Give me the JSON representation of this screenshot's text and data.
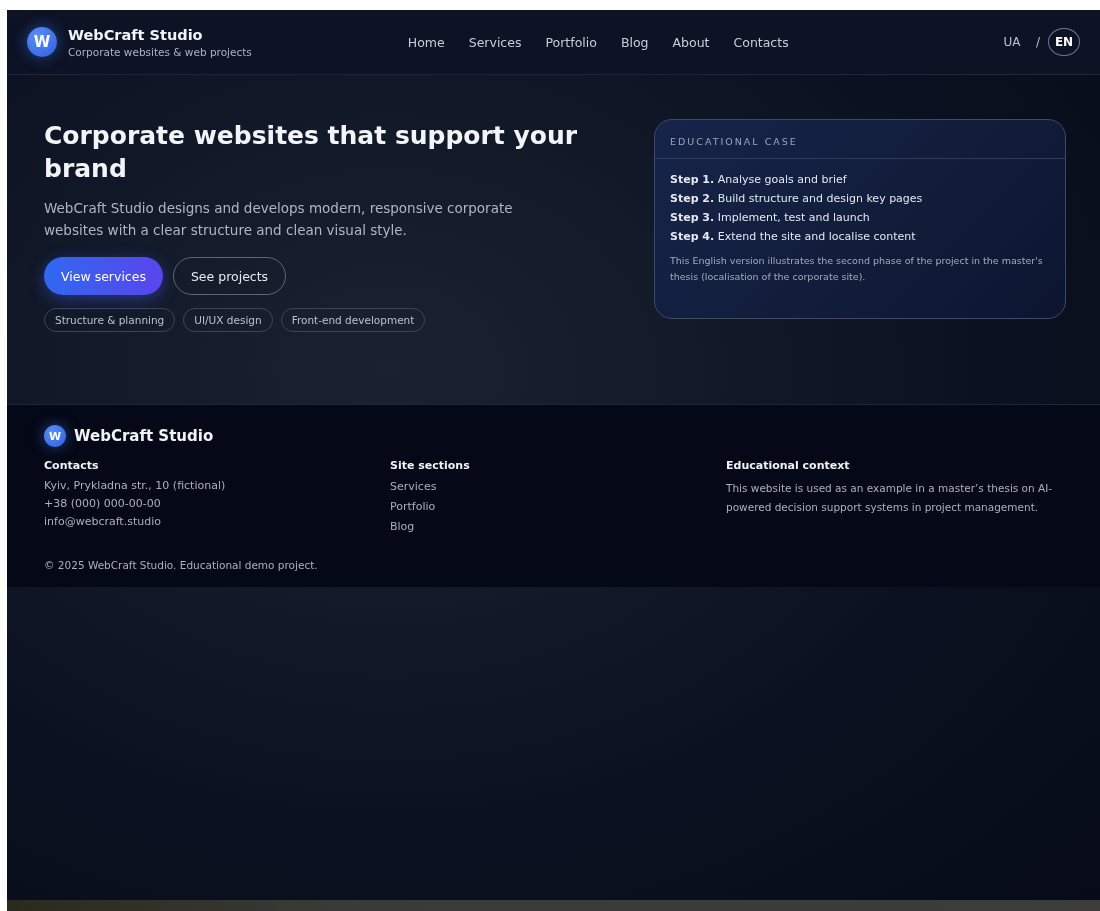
{
  "header": {
    "logo_letter": "W",
    "brand": "WebCraft Studio",
    "tagline": "Corporate websites & web projects",
    "nav": [
      {
        "label": "Home"
      },
      {
        "label": "Services"
      },
      {
        "label": "Portfolio"
      },
      {
        "label": "Blog"
      },
      {
        "label": "About"
      },
      {
        "label": "Contacts"
      }
    ],
    "languages": [
      {
        "label": "UA",
        "selected": false
      },
      {
        "label": "EN",
        "selected": true
      }
    ],
    "language_separator": "/"
  },
  "hero": {
    "title": "Corporate websites that support your brand",
    "lead": "WebCraft Studio designs and develops modern, responsive corporate websites with a clear structure and clean visual style.",
    "buttons": [
      {
        "label": "View services",
        "kind": "primary"
      },
      {
        "label": "See projects",
        "kind": "outline"
      }
    ],
    "tags": [
      "Structure & planning",
      "UI/UX design",
      "Front-end development"
    ],
    "case_card": {
      "title": "EDUCATIONAL CASE",
      "steps": [
        "**Step 1.** Analyse goals and brief",
        "**Step 2.** Build structure and design key pages",
        "**Step 3.** Implement, test and launch",
        "**Step 4.** Extend the site and localise content"
      ],
      "note": "This English version illustrates the second phase of the project in the master's thesis (localisation of the corporate site)."
    }
  },
  "footer": {
    "logo_letter": "W",
    "brand": "WebCraft Studio",
    "columns": [
      {
        "heading": "Contacts",
        "kind": "text",
        "lines": [
          "Kyiv, Prykladna str., 10 (fictional)",
          "+38 (000) 000-00-00",
          "info@webcraft.studio"
        ]
      },
      {
        "heading": "Site sections",
        "kind": "links",
        "lines": [
          "Services",
          "Portfolio",
          "Blog"
        ]
      },
      {
        "heading": "Educational context",
        "kind": "paragraph",
        "lines": [
          "This website is used as an example in a master’s thesis on AI-powered decision support systems in project management."
        ]
      }
    ],
    "copyright": "© 2025 WebCraft Studio. Educational demo project."
  }
}
